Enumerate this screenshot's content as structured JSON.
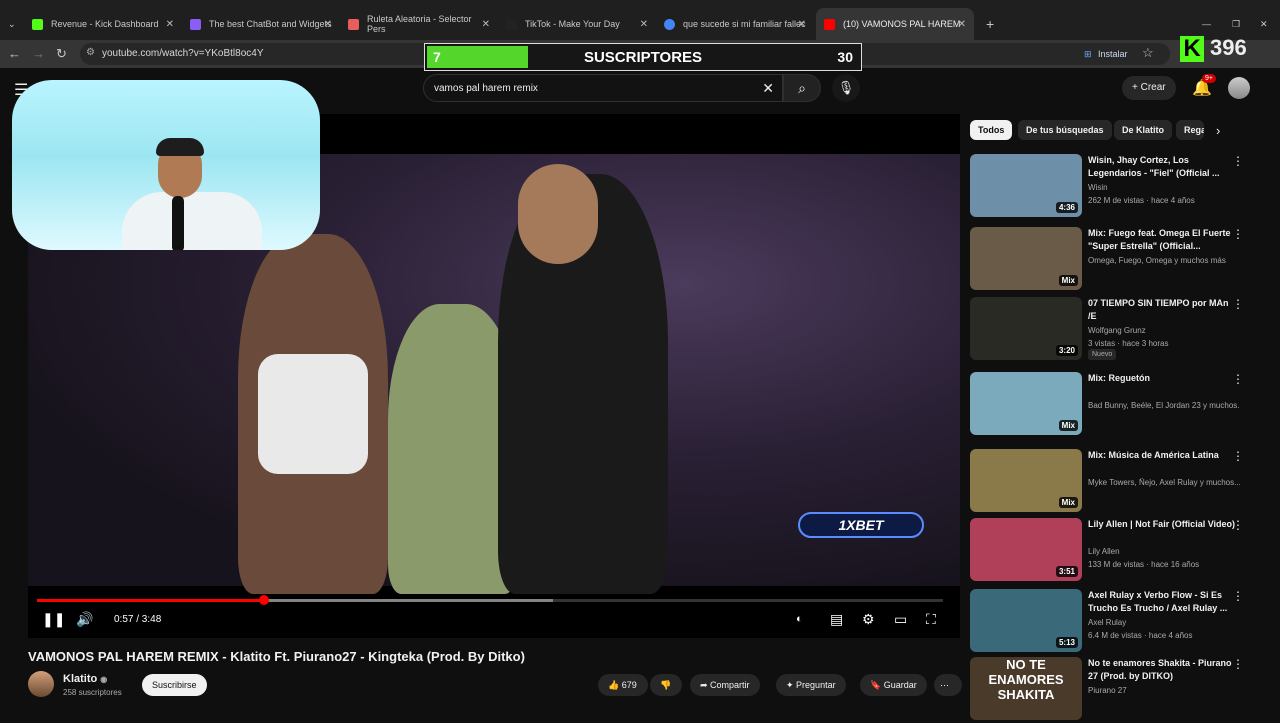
{
  "browser": {
    "tabs": [
      {
        "label": "Revenue - Kick Dashboard",
        "color": "#53fc18"
      },
      {
        "label": "The best ChatBot and Widgets",
        "color": "#8b5cf6"
      },
      {
        "label": "Ruleta Aleatoria - Selector Pers",
        "color": "#e85d5d"
      },
      {
        "label": "TikTok - Make Your Day",
        "color": "#222222"
      },
      {
        "label": "que sucede si mi familiar fallec",
        "color": "#4285f4"
      },
      {
        "label": "(10) VAMONOS PAL HAREM",
        "color": "#ff0000"
      }
    ],
    "url": "youtube.com/watch?v=YKoBtl8oc4Y",
    "install_label": "Instalar"
  },
  "overlay": {
    "sub_current": "7",
    "sub_label": "SUSCRIPTORES",
    "sub_goal": "30",
    "sub_progress": 0.233,
    "kick_logo": "K",
    "kick_count": "396"
  },
  "youtube": {
    "search_value": "vamos pal harem remix",
    "create_label": "Crear",
    "notif_badge": "9+"
  },
  "player": {
    "time_label": "0:57 / 3:48",
    "played_fraction": 0.25,
    "buffered_fraction": 0.57,
    "ad_text": "1XBET"
  },
  "video": {
    "title": "VAMONOS PAL HAREM REMIX - Klatito Ft. Piurano27 - Kingteka (Prod. By Ditko)",
    "channel": "Klatito",
    "subscribers": "258 suscriptores",
    "subscribe_label": "Suscribirse",
    "likes": "679",
    "share_label": "Compartir",
    "ask_label": "Preguntar",
    "save_label": "Guardar"
  },
  "chips": [
    "Todos",
    "De tus búsquedas",
    "De Klatito",
    "Rega"
  ],
  "recommendations": [
    {
      "title": "Wisin, Jhay Cortez, Los Legendarios - \"Fiel\" (Official ...",
      "channel": "Wisin",
      "meta": "262 M de vistas · hace 4 años",
      "badge": "4:36",
      "thumb": "#6d8fa8"
    },
    {
      "title": "Mix: Fuego feat. Omega El Fuerte \"Super Estrella\" (Official...",
      "channel": "Omega, Fuego, Omega y muchos más",
      "meta": "",
      "badge": "Mix",
      "thumb": "#6a5a48"
    },
    {
      "title": "07 TIEMPO SIN TIEMPO por MAn /E",
      "channel": "Wolfgang Grunz",
      "meta": "3 vistas · hace 3 horas",
      "badge": "3:20",
      "new_label": "Nuevo",
      "thumb": "#2a2a24"
    },
    {
      "title": "Mix: Reguetón",
      "channel": "Bad Bunny, Beéle, El Jordan 23 y muchos...",
      "meta": "",
      "badge": "Mix",
      "thumb": "#7aaabb"
    },
    {
      "title": "Mix: Música de América Latina",
      "channel": "Myke Towers, Ñejo, Axel Rulay y muchos...",
      "meta": "",
      "badge": "Mix",
      "thumb": "#8a7a4a"
    },
    {
      "title": "Lily Allen | Not Fair (Official Video)",
      "channel": "Lily Allen",
      "meta": "133 M de vistas · hace 16 años",
      "badge": "3:51",
      "thumb": "#b0405a"
    },
    {
      "title": "Axel Rulay x Verbo Flow - Si Es Trucho Es Trucho / Axel Rulay ...",
      "channel": "Axel Rulay",
      "meta": "6.4 M de vistas · hace 4 años",
      "badge": "5:13",
      "thumb": "#3a6a7a"
    },
    {
      "title": "No te enamores Shakita - Piurano 27 (Prod. by DITKO)",
      "channel": "Piurano 27",
      "meta": "",
      "badge": "",
      "thumb_text": "NO TE ENAMORES SHAKITA",
      "thumb": "#4a3a2a"
    }
  ]
}
